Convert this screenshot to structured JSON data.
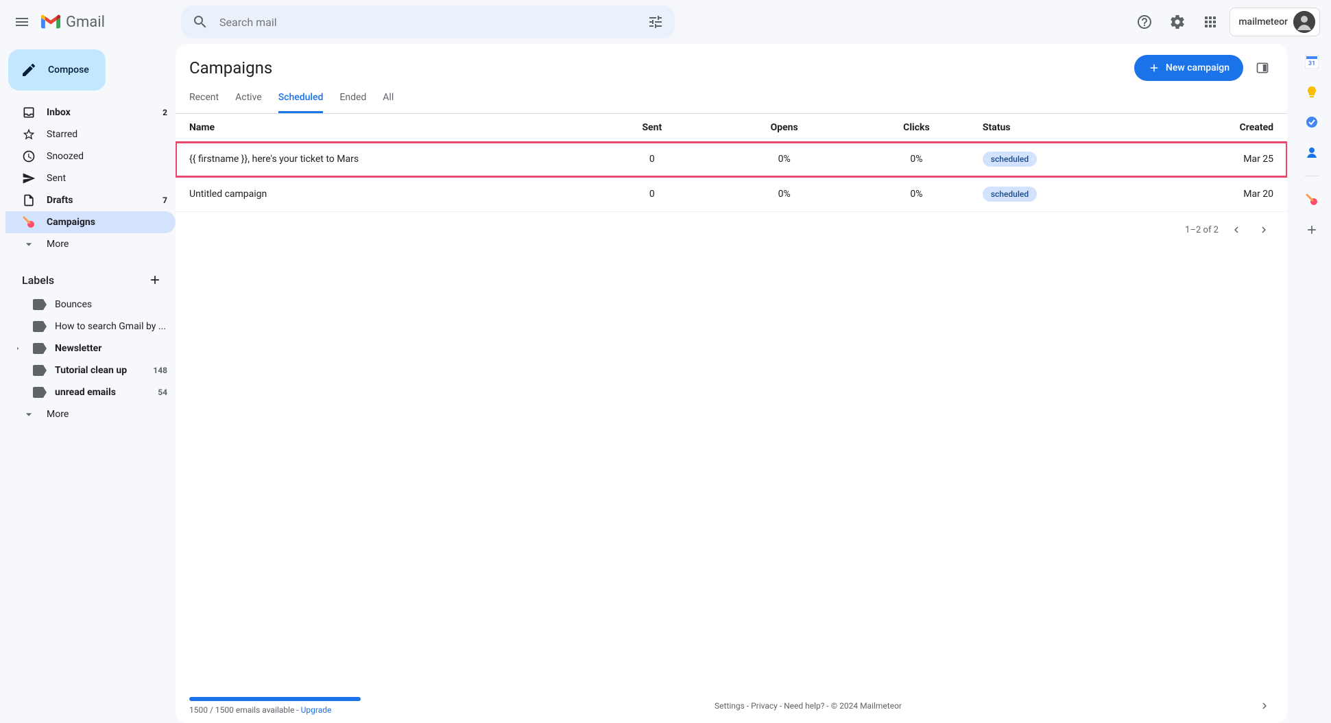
{
  "header": {
    "logo_text": "Gmail",
    "search_placeholder": "Search mail",
    "account_name": "mailmeteor"
  },
  "sidebar": {
    "compose_label": "Compose",
    "nav": [
      {
        "icon": "inbox",
        "label": "Inbox",
        "count": "2",
        "bold": true
      },
      {
        "icon": "star",
        "label": "Starred",
        "count": ""
      },
      {
        "icon": "clock",
        "label": "Snoozed",
        "count": ""
      },
      {
        "icon": "send",
        "label": "Sent",
        "count": ""
      },
      {
        "icon": "draft",
        "label": "Drafts",
        "count": "7",
        "bold": true
      },
      {
        "icon": "meteor",
        "label": "Campaigns",
        "count": "",
        "active": true,
        "bold": true
      },
      {
        "icon": "more",
        "label": "More",
        "count": ""
      }
    ],
    "labels_title": "Labels",
    "labels": [
      {
        "label": "Bounces",
        "count": ""
      },
      {
        "label": "How to search Gmail by ...",
        "count": ""
      },
      {
        "label": "Newsletter",
        "count": "",
        "bold": true,
        "expandable": true
      },
      {
        "label": "Tutorial clean up",
        "count": "148",
        "bold": true
      },
      {
        "label": "unread emails",
        "count": "54",
        "bold": true
      }
    ],
    "labels_more": "More"
  },
  "main": {
    "title": "Campaigns",
    "new_button": "New campaign",
    "tabs": [
      {
        "label": "Recent"
      },
      {
        "label": "Active"
      },
      {
        "label": "Scheduled",
        "active": true
      },
      {
        "label": "Ended"
      },
      {
        "label": "All"
      }
    ],
    "columns": {
      "name": "Name",
      "sent": "Sent",
      "opens": "Opens",
      "clicks": "Clicks",
      "status": "Status",
      "created": "Created"
    },
    "rows": [
      {
        "name": "{{ firstname }}, here's your ticket to Mars",
        "sent": "0",
        "opens": "0%",
        "clicks": "0%",
        "status": "scheduled",
        "created": "Mar 25",
        "highlighted": true
      },
      {
        "name": "Untitled campaign",
        "sent": "0",
        "opens": "0%",
        "clicks": "0%",
        "status": "scheduled",
        "created": "Mar 20"
      }
    ],
    "pagination": "1–2 of 2"
  },
  "footer": {
    "quota": "1500 / 1500 emails available - ",
    "upgrade": "Upgrade",
    "links": "Settings - Privacy - Need help? - © 2024 Mailmeteor"
  }
}
